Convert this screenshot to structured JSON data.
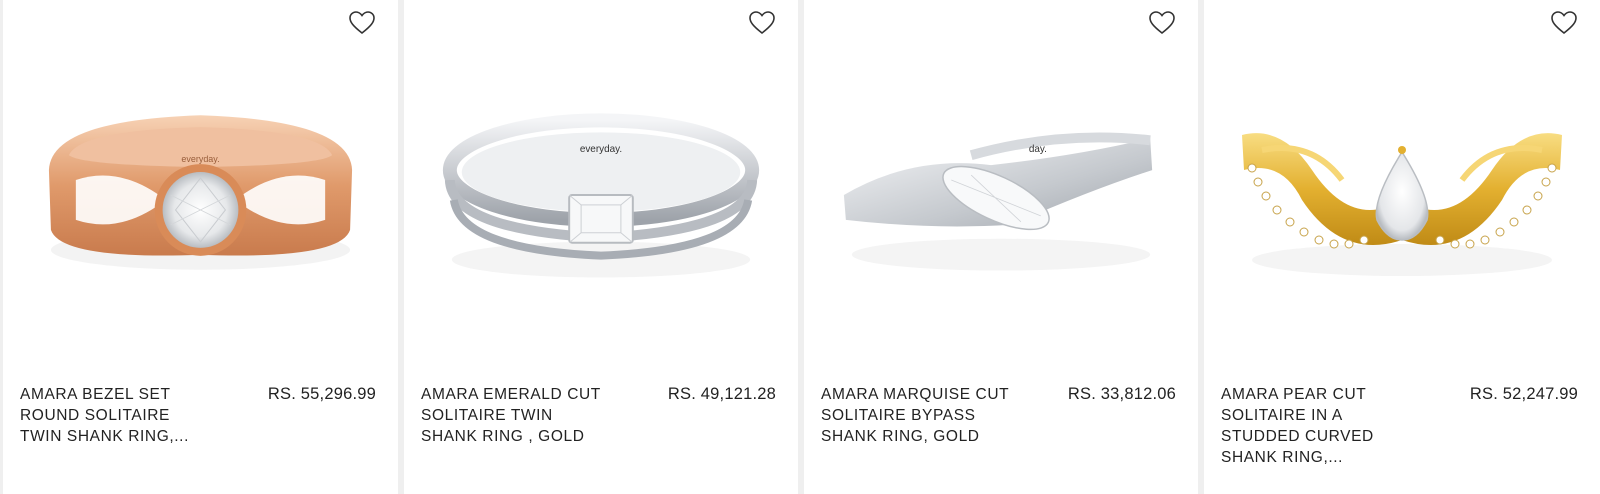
{
  "products": [
    {
      "title": "AMARA BEZEL SET ROUND SOLITAIRE TWIN SHANK RING,...",
      "price": "RS. 55,296.99",
      "metal": "rose",
      "engraving": "everyday."
    },
    {
      "title": "AMARA EMERALD CUT SOLITAIRE TWIN SHANK RING , GOLD",
      "price": "RS. 49,121.28",
      "metal": "white",
      "engraving": "everyday."
    },
    {
      "title": "AMARA MARQUISE CUT SOLITAIRE BYPASS SHANK RING, GOLD",
      "price": "RS. 33,812.06",
      "metal": "white",
      "engraving": "day."
    },
    {
      "title": "AMARA PEAR CUT SOLITAIRE IN A STUDDED CURVED SHANK RING,...",
      "price": "RS. 52,247.99",
      "metal": "yellow",
      "engraving": ""
    }
  ],
  "colors": {
    "rose": "#e8a77c",
    "white": "#d6d8dc",
    "yellow": "#e9b93a"
  },
  "icons": {
    "wishlist": "heart-outline-icon"
  }
}
